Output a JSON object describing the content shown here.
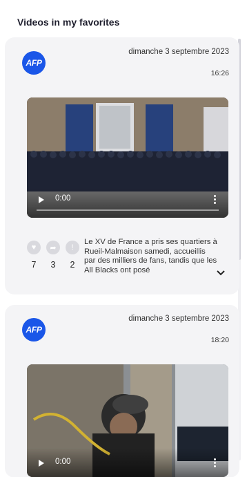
{
  "header": {
    "title": "Videos in my favorites"
  },
  "cards": [
    {
      "source": "AFP",
      "date": "dimanche 3 septembre 2023",
      "time": "16:26",
      "video_time": "0:00",
      "likes": "7",
      "shares": "3",
      "alerts": "2",
      "description": "Le XV de France a pris ses quartiers à Rueil-Malmaison samedi, accueillis par des milliers de fans, tandis que les All Blacks ont posé"
    },
    {
      "source": "AFP",
      "date": "dimanche 3 septembre 2023",
      "time": "18:20",
      "video_time": "0:00"
    }
  ],
  "colors": {
    "brand": "#1a56e8",
    "card_bg": "#f4f4f6"
  },
  "icons": [
    "heart-icon",
    "share-icon",
    "alert-icon",
    "play-icon",
    "more-vertical-icon",
    "chevron-down-icon"
  ]
}
